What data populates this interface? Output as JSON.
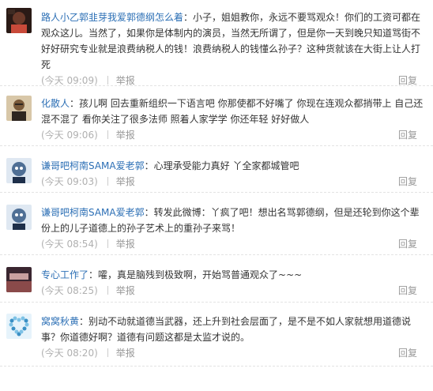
{
  "comments": [
    {
      "author": "路人小乙郭韭芽我爱郭德纲怎么着",
      "text": "小子，姐姐教你，永远不要骂观众！你们的工资可都在观众这儿。当然了，如果你是体制内的演员，当然无所谓了，但是你一天到晚只知道骂街不好好研究专业就是浪费纳税人的钱！浪费纳税人的钱懂么孙子？这种货就该在大街上让人打死",
      "time": "(今天 09:09)",
      "report": "举报",
      "reply": "回复",
      "avatar": "avatar-dark-photo",
      "colors": [
        "#2a1a16",
        "#6b3a2a",
        "#c94a3a"
      ]
    },
    {
      "author": "化散人",
      "text": "孩儿啊  回去重新组织一下语言吧  你那使都不好嘴了  你现在连观众都捎带上  自己还混不混了  看你关注了很多法师  照着人家学学  你还年轻  好好做人",
      "time": "(今天 09:06)",
      "report": "举报",
      "reply": "回复",
      "avatar": "avatar-man-portrait",
      "colors": [
        "#d8c7a8",
        "#7a5a3a",
        "#2e2620"
      ]
    },
    {
      "author": "谦哥吧柯南SAMA爱老郭",
      "text": "心理承受能力真好  丫全家都城管吧",
      "time": "(今天 09:03)",
      "report": "举报",
      "reply": "回复",
      "avatar": "avatar-cartoon-character",
      "colors": [
        "#dfe8f2",
        "#4f6f95",
        "#1e2f4a"
      ]
    },
    {
      "author": "谦哥吧柯南SAMA爱老郭",
      "text": "转发此微博：丫疯了吧！想出名骂郭德纲，但是还轮到你这个辈份上的儿子道德上的孙子艺术上的重孙子来骂！",
      "time": "(今天 08:54)",
      "report": "举报",
      "reply": "回复",
      "avatar": "avatar-cartoon-character",
      "colors": [
        "#dfe8f2",
        "#4f6f95",
        "#1e2f4a"
      ]
    },
    {
      "author": "专心工作了",
      "text": "嚯，真是脑残到极致啊，开始骂普通观众了~~~",
      "time": "(今天 08:25)",
      "report": "举报",
      "reply": "回复",
      "avatar": "avatar-landscape-photo",
      "colors": [
        "#3a2630",
        "#8a4a4a",
        "#c9a0a0"
      ]
    },
    {
      "author": "窝窝秋黄",
      "text": "别动不动就道德当武器，还上升到社会层面了，是不是不如人家就想用道德说事？你道德好啊？道德有问题这都是太监才说的。",
      "time": "(今天 08:20)",
      "report": "举报",
      "reply": "回复",
      "avatar": "avatar-heart-beads",
      "colors": [
        "#e6f3fb",
        "#7ec2e6",
        "#3a8fc4"
      ]
    }
  ]
}
